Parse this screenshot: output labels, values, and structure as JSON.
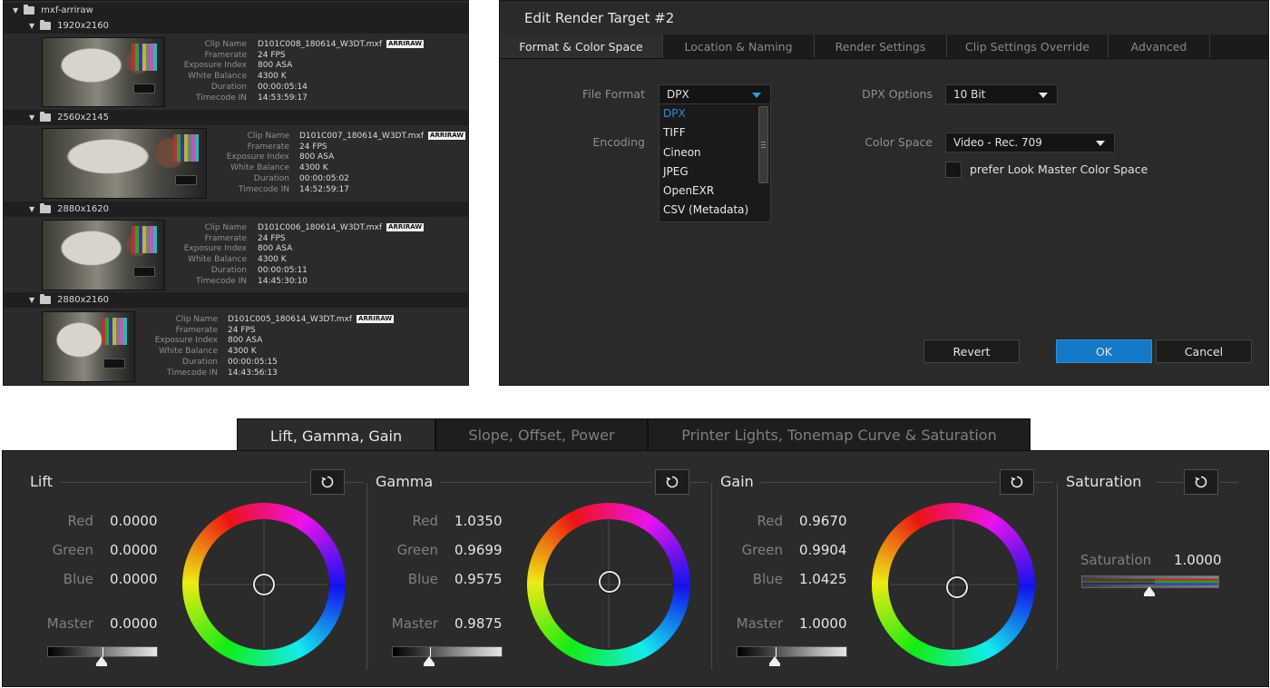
{
  "clip_browser": {
    "root_folder": "mxf-arriraw",
    "field_labels": [
      "Clip Name",
      "Framerate",
      "Exposure Index",
      "White Balance",
      "Duration",
      "Timecode IN"
    ],
    "groups": [
      {
        "folder": "1920x2160",
        "clip_name": "D101C008_180614_W3DT.mxf",
        "badge": "ARRIRAW",
        "framerate": "24 FPS",
        "exposure_index": "800 ASA",
        "white_balance": "4300 K",
        "duration": "00:00:05:14",
        "timecode_in": "14:53:59:17"
      },
      {
        "folder": "2560x2145",
        "clip_name": "D101C007_180614_W3DT.mxf",
        "badge": "ARRIRAW",
        "framerate": "24 FPS",
        "exposure_index": "800 ASA",
        "white_balance": "4300 K",
        "duration": "00:00:05:02",
        "timecode_in": "14:52:59:17"
      },
      {
        "folder": "2880x1620",
        "clip_name": "D101C006_180614_W3DT.mxf",
        "badge": "ARRIRAW",
        "framerate": "24 FPS",
        "exposure_index": "800 ASA",
        "white_balance": "4300 K",
        "duration": "00:00:05:11",
        "timecode_in": "14:45:30:10"
      },
      {
        "folder": "2880x2160",
        "clip_name": "D101C005_180614_W3DT.mxf",
        "badge": "ARRIRAW",
        "framerate": "24 FPS",
        "exposure_index": "800 ASA",
        "white_balance": "4300 K",
        "duration": "00:00:05:15",
        "timecode_in": "14:43:56:13"
      }
    ]
  },
  "render_dialog": {
    "title": "Edit Render Target  #2",
    "tabs": [
      "Format & Color Space",
      "Location & Naming",
      "Render Settings",
      "Clip Settings Override",
      "Advanced"
    ],
    "active_tab": "Format & Color Space",
    "file_format_label": "File Format",
    "file_format_value": "DPX",
    "file_format_options": [
      "DPX",
      "TIFF",
      "Cineon",
      "JPEG",
      "OpenEXR",
      "CSV (Metadata)"
    ],
    "encoding_label": "Encoding",
    "dpx_options_label": "DPX Options",
    "dpx_options_value": "10 Bit",
    "color_space_label": "Color Space",
    "color_space_value": "Video - Rec. 709",
    "prefer_look_label": "prefer Look Master Color Space",
    "prefer_look_checked": false,
    "buttons": {
      "revert": "Revert",
      "ok": "OK",
      "cancel": "Cancel"
    },
    "accent_color": "#1479c9"
  },
  "color_panel": {
    "tabs": [
      "Lift, Gamma, Gain",
      "Slope, Offset, Power",
      "Printer Lights, Tonemap Curve & Saturation"
    ],
    "active_tab": "Lift, Gamma, Gain",
    "channel_labels": {
      "red": "Red",
      "green": "Green",
      "blue": "Blue",
      "master": "Master"
    },
    "sections": {
      "lift": {
        "title": "Lift",
        "red": "0.0000",
        "green": "0.0000",
        "blue": "0.0000",
        "master": "0.0000"
      },
      "gamma": {
        "title": "Gamma",
        "red": "1.0350",
        "green": "0.9699",
        "blue": "0.9575",
        "master": "0.9875"
      },
      "gain": {
        "title": "Gain",
        "red": "0.9670",
        "green": "0.9904",
        "blue": "1.0425",
        "master": "1.0000"
      }
    },
    "saturation": {
      "title": "Saturation",
      "label": "Saturation",
      "value": "1.0000"
    }
  }
}
